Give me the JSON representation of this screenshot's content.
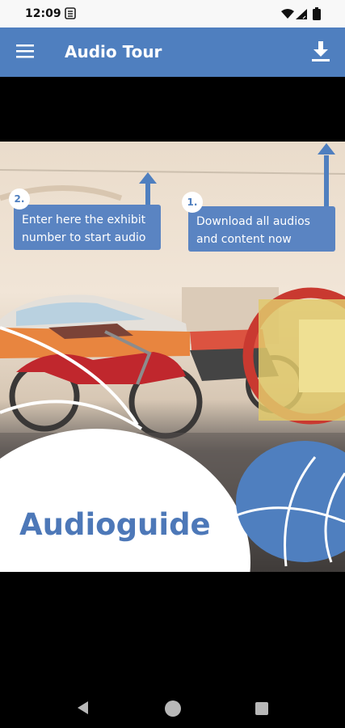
{
  "status_bar": {
    "time": "12:09"
  },
  "app_bar": {
    "title": "Audio Tour"
  },
  "banner": {
    "callout_2": {
      "step": "2.",
      "text": "Enter here the exhibit number to start audio"
    },
    "callout_1": {
      "step": "1.",
      "text": "Download all audios and content now"
    },
    "title": "Audioguide"
  },
  "colors": {
    "app_bar": "#4f7fbf",
    "accent_blue": "#4d78b8"
  },
  "icons": {
    "menu": "hamburger-menu-icon",
    "download": "download-icon",
    "nav_back": "back-triangle-icon",
    "nav_home": "home-circle-icon",
    "nav_recents": "recents-square-icon"
  }
}
